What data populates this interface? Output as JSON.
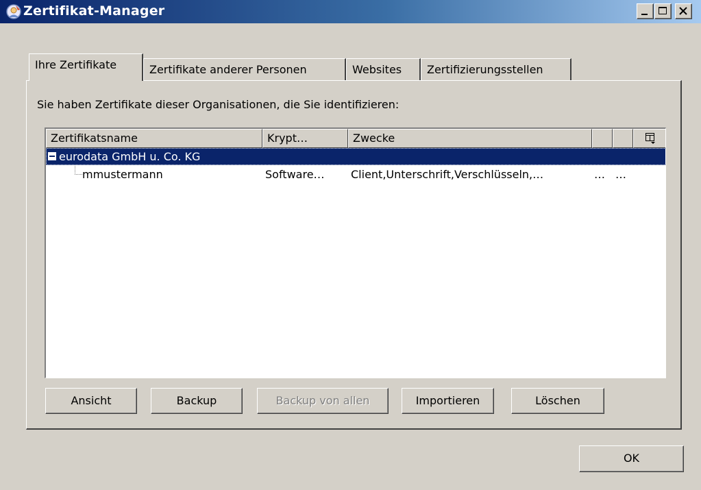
{
  "window": {
    "title": "Zertifikat-Manager",
    "app_icon": "certificate-manager-icon",
    "controls": [
      "minimize-icon",
      "maximize-icon",
      "close-icon"
    ]
  },
  "tabs": [
    {
      "label": "Ihre Zertifikate",
      "active": true
    },
    {
      "label": "Zertifikate anderer Personen",
      "active": false
    },
    {
      "label": "Websites",
      "active": false
    },
    {
      "label": "Zertifizierungsstellen",
      "active": false
    }
  ],
  "panel": {
    "description": "Sie haben Zertifikate dieser Organisationen, die Sie identifizieren:"
  },
  "tree": {
    "columns": [
      "Zertifikatsname",
      "Krypt…",
      "Zwecke",
      "",
      ""
    ],
    "column_picker_icon": "column-picker-icon",
    "rows": [
      {
        "name": "eurodata GmbH u. Co. KG",
        "krypt": "",
        "zwecke": "",
        "extra1": "",
        "extra2": "",
        "type": "organization",
        "expanded": true,
        "selected": true
      },
      {
        "name": "mmustermann",
        "krypt": "Software…",
        "zwecke": "Client,Unterschrift,Verschlüsseln,…",
        "extra1": "…",
        "extra2": "…",
        "type": "certificate",
        "selected": false
      }
    ]
  },
  "buttons": {
    "view": "Ansicht",
    "backup": "Backup",
    "backup_all": "Backup von allen",
    "import": "Importieren",
    "delete": "Löschen",
    "ok": "OK"
  },
  "colors": {
    "titlebar_start": "#0a246a",
    "titlebar_end": "#a6caf0",
    "selection": "#0a246a",
    "face": "#d4d0c8"
  }
}
